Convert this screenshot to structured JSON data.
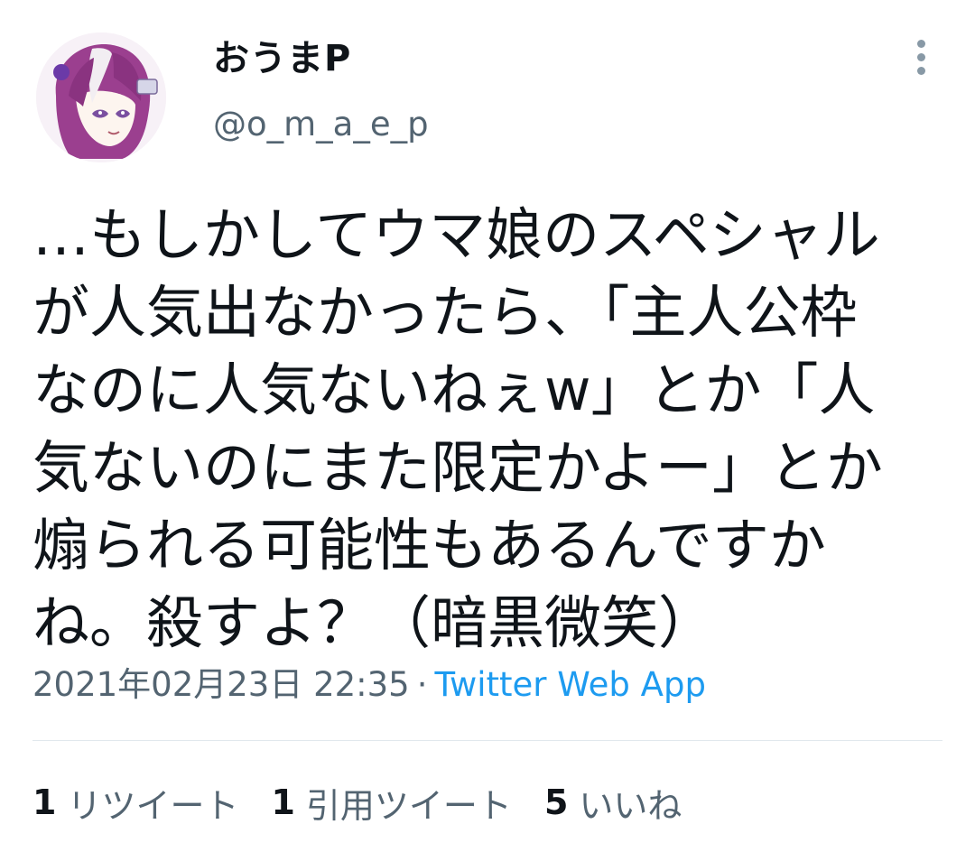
{
  "author": {
    "display_name": "おうまP",
    "handle": "@o_m_a_e_p"
  },
  "tweet": {
    "text": "…もしかしてウマ娘のスペシャル\nが人気出なかったら、「主人公枠\nなのに人気ないねぇw」とか「人\n気ないのにまた限定かよー」とか\n煽られる可能性もあるんですか\nね。殺すよ？（暗黒微笑）",
    "timestamp": "2021年02月23日 22:35",
    "separator": "·",
    "source": "Twitter Web App"
  },
  "stats": {
    "retweets_count": "1",
    "retweets_label": "リツイート",
    "quotes_count": "1",
    "quotes_label": "引用ツイート",
    "likes_count": "5",
    "likes_label": "いいね"
  },
  "icons": {
    "more": "more-vertical-icon",
    "avatar": "avatar-image"
  },
  "colors": {
    "text": "#0f1419",
    "secondary": "#536471",
    "link": "#1d9bf0",
    "divider": "#e1e8ed"
  }
}
